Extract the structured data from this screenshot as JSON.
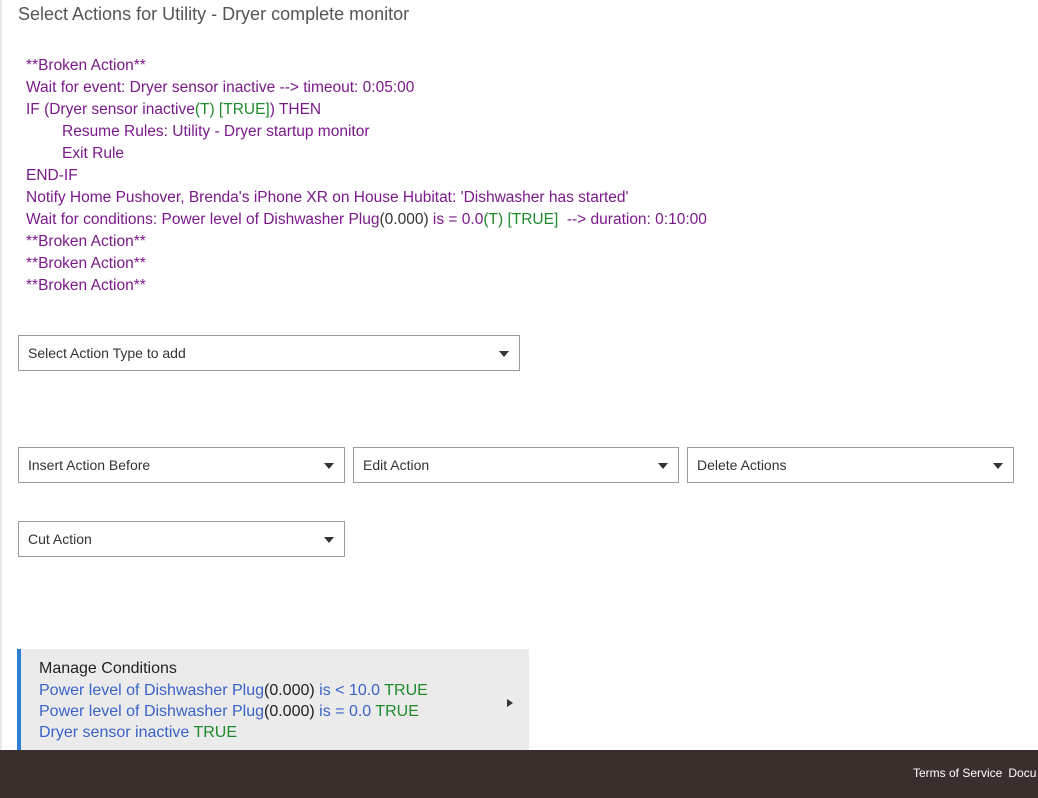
{
  "title": "Select Actions for Utility - Dryer complete monitor",
  "actions": {
    "l1": "**Broken Action**",
    "l2": "Wait for event: Dryer sensor inactive --> timeout: 0:05:00",
    "l3_a": "IF (Dryer sensor inactive",
    "l3_t": "(T) [TRUE]",
    "l3_b": ") THEN",
    "l4": "Resume Rules: Utility - Dryer startup monitor",
    "l5": "Exit Rule",
    "l6": "END-IF",
    "l7": "Notify Home Pushover, Brenda's iPhone XR on House Hubitat: 'Dishwasher has started'",
    "l8_a": "Wait for conditions: Power level of Dishwasher Plug",
    "l8_v": "(0.000)",
    "l8_b": " is = 0.0",
    "l8_t": "(T) [TRUE]",
    "l8_c": "  --> duration: 0:10:00",
    "l9": "**Broken Action**",
    "l10": "**Broken Action**",
    "l11": "**Broken Action**"
  },
  "selects": {
    "action_type": "Select Action Type to add",
    "insert_before": "Insert Action Before",
    "edit": "Edit Action",
    "delete": "Delete Actions",
    "cut": "Cut Action"
  },
  "conditions": {
    "heading": "Manage Conditions",
    "c1_a": "Power level of Dishwasher Plug",
    "c1_v": "(0.000)",
    "c1_b": " is < 10.0 ",
    "c1_t": "TRUE",
    "c2_a": "Power level of Dishwasher Plug",
    "c2_v": "(0.000)",
    "c2_b": " is = 0.0 ",
    "c2_t": "TRUE",
    "c3_a": "Dryer sensor inactive ",
    "c3_t": "TRUE"
  },
  "footer": {
    "terms": "Terms of Service",
    "docs": "Docu"
  }
}
